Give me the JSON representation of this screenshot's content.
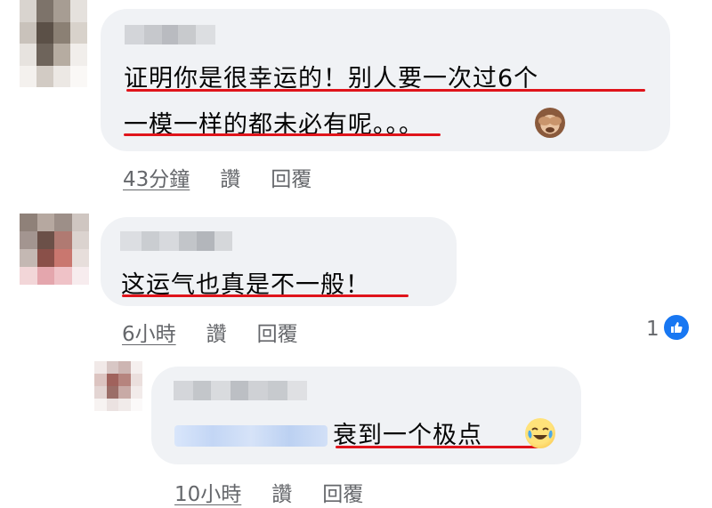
{
  "comments": [
    {
      "line1": "证明你是很幸运的！别人要一次过6个",
      "line2": "一模一样的都未必有呢。。。",
      "emoji": "see-no-evil-monkey",
      "time": "43分鐘",
      "like_label": "讚",
      "reply_label": "回覆"
    },
    {
      "line1": "这运气也真是不一般！",
      "time": "6小時",
      "like_label": "讚",
      "reply_label": "回覆",
      "reaction_count": "1",
      "reaction_type": "like"
    },
    {
      "line1": "衰到一个极点",
      "emoji": "face-with-tears-of-joy",
      "time": "10小時",
      "like_label": "讚",
      "reply_label": "回覆"
    }
  ],
  "colors": {
    "bubble": "#f0f2f5",
    "underline": "#e0141b",
    "meta": "#65676b",
    "like_badge": "#1877f2"
  }
}
